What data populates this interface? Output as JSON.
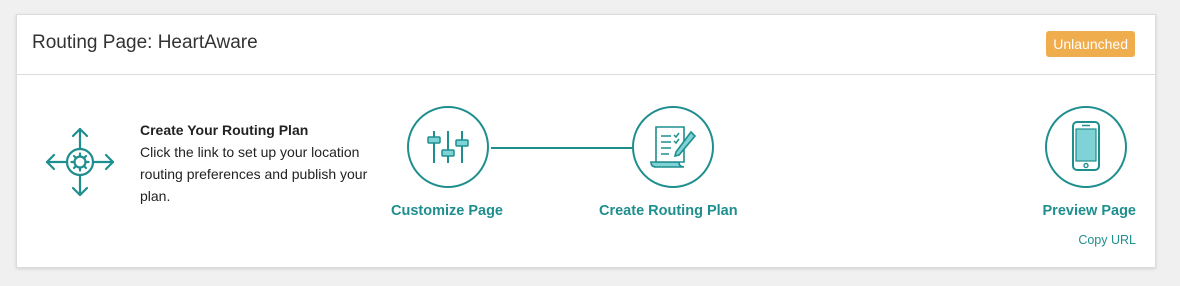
{
  "header": {
    "title": "Routing Page: HeartAware",
    "status": "Unlaunched"
  },
  "intro": {
    "icon": "move-arrows-gear-icon",
    "heading": "Create Your Routing Plan",
    "body": "Click the link to set up your location routing preferences and publish your plan."
  },
  "steps": [
    {
      "label": "Customize Page",
      "icon": "sliders-icon"
    },
    {
      "label": "Create Routing Plan",
      "icon": "checklist-pen-icon"
    },
    {
      "label": "Preview Page",
      "icon": "mobile-phone-icon"
    }
  ],
  "copy_url": "Copy URL",
  "colors": {
    "accent": "#1f8e8e",
    "accent_light": "#7fd3d6",
    "badge": "#f0ad4e"
  }
}
